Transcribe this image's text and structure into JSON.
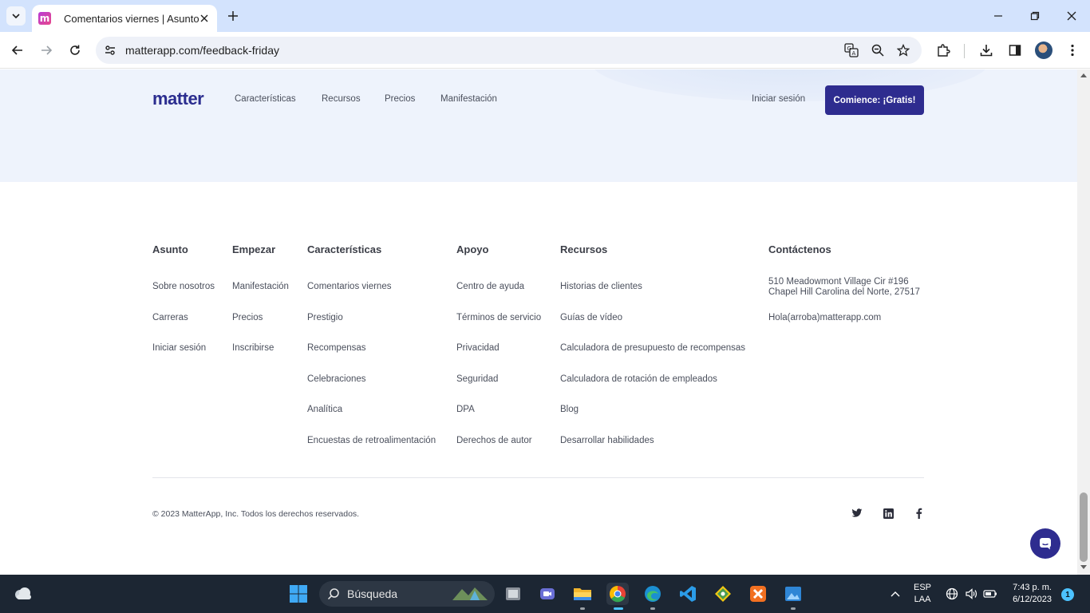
{
  "browser": {
    "tab_title": "Comentarios viernes | Asunto",
    "favicon_letter": "m",
    "url": "matterapp.com/feedback-friday"
  },
  "header": {
    "logo": "matter",
    "nav": [
      "Características",
      "Recursos",
      "Precios",
      "Manifestación"
    ],
    "signin": "Iniciar sesión",
    "cta": "Comience: ¡Gratis!"
  },
  "footer": {
    "columns": [
      {
        "title": "Asunto",
        "items": [
          "Sobre nosotros",
          "Carreras",
          "Iniciar sesión"
        ]
      },
      {
        "title": "Empezar",
        "items": [
          "Manifestación",
          "Precios",
          "Inscribirse"
        ]
      },
      {
        "title": "Características",
        "items": [
          "Comentarios viernes",
          "Prestigio",
          "Recompensas",
          "Celebraciones",
          "Analítica",
          "Encuestas de retroalimentación"
        ]
      },
      {
        "title": "Apoyo",
        "items": [
          "Centro de ayuda",
          "Términos de servicio",
          "Privacidad",
          "Seguridad",
          "DPA",
          "Derechos de autor"
        ]
      },
      {
        "title": "Recursos",
        "items": [
          "Historias de clientes",
          "Guías de vídeo",
          "Calculadora de presupuesto de recompensas",
          "Calculadora de rotación de empleados",
          "Blog",
          "Desarrollar habilidades"
        ]
      }
    ],
    "contact": {
      "title": "Contáctenos",
      "address_line1": "510 Meadowmont Village Cir #196",
      "address_line2": "Chapel Hill Carolina del Norte, 27517",
      "email": "Hola(arroba)matterapp.com"
    },
    "copyright": "© 2023 MatterApp, Inc. Todos los derechos reservados.",
    "social_icons": [
      "twitter-icon",
      "linkedin-icon",
      "facebook-icon"
    ]
  },
  "taskbar": {
    "search_label": "Búsqueda",
    "lang_line1": "ESP",
    "lang_line2": "LAA",
    "time": "7:43 p. m.",
    "date": "6/12/2023",
    "notification_count": "1"
  },
  "colors": {
    "brand": "#2e2c8f",
    "header_bg": "#eef3fc",
    "tabbar_bg": "#d3e3fd",
    "taskbar_bg": "#1c2633"
  }
}
